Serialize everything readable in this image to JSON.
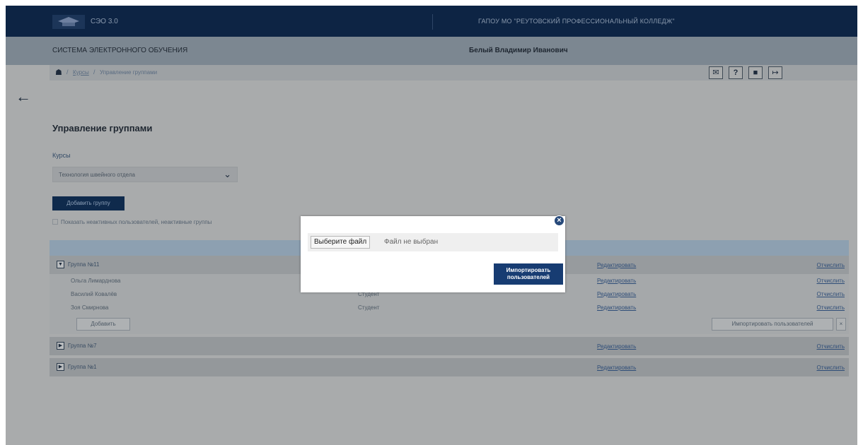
{
  "topbar": {
    "app_title": "СЭО 3.0",
    "org_name": "ГАПОУ МО \"РЕУТОВСКИЙ ПРОФЕССИОНАЛЬНЫЙ КОЛЛЕДЖ\""
  },
  "subbar": {
    "system_name": "СИСТЕМА ЭЛЕКТРОННОГО ОБУЧЕНИЯ",
    "user_name": "Белый Владимир Иванович"
  },
  "breadcrumb": {
    "items": [
      "Курсы",
      "Управление группами"
    ],
    "separator": "/"
  },
  "header_icons": [
    "mail-icon",
    "help-icon",
    "profile-icon",
    "logout-icon"
  ],
  "page": {
    "title": "Управление группами",
    "courses_label": "Курсы",
    "course_selected": "Технология швейного отдела",
    "add_group_label": "Добавить группу",
    "show_inactive_label": "Показать неактивных пользователей, неактивные группы"
  },
  "table": {
    "edit_label": "Редактировать",
    "delete_label": "Отчислить",
    "add_member_label": "Добавить",
    "import_users_label": "Импортировать пользователей",
    "import_close": "×",
    "groups": [
      {
        "name": "Группа №11",
        "expanded": true,
        "members": [
          {
            "name": "Ольга Лимарднова",
            "role": ""
          },
          {
            "name": "Василий Ковалёв",
            "role": "Студент"
          },
          {
            "name": "Зоя Смирнова",
            "role": "Студент"
          }
        ]
      },
      {
        "name": "Группа №7",
        "expanded": false,
        "members": []
      },
      {
        "name": "Группа №1",
        "expanded": false,
        "members": []
      }
    ]
  },
  "modal": {
    "file_button": "Выберите файл",
    "file_status": "Файл не выбран",
    "submit_line1": "Импортировать",
    "submit_line2": "пользователей",
    "close_glyph": "×"
  },
  "colors": {
    "navy": "#0d2444",
    "accent": "#173c72",
    "overlay": "#a9abac"
  }
}
